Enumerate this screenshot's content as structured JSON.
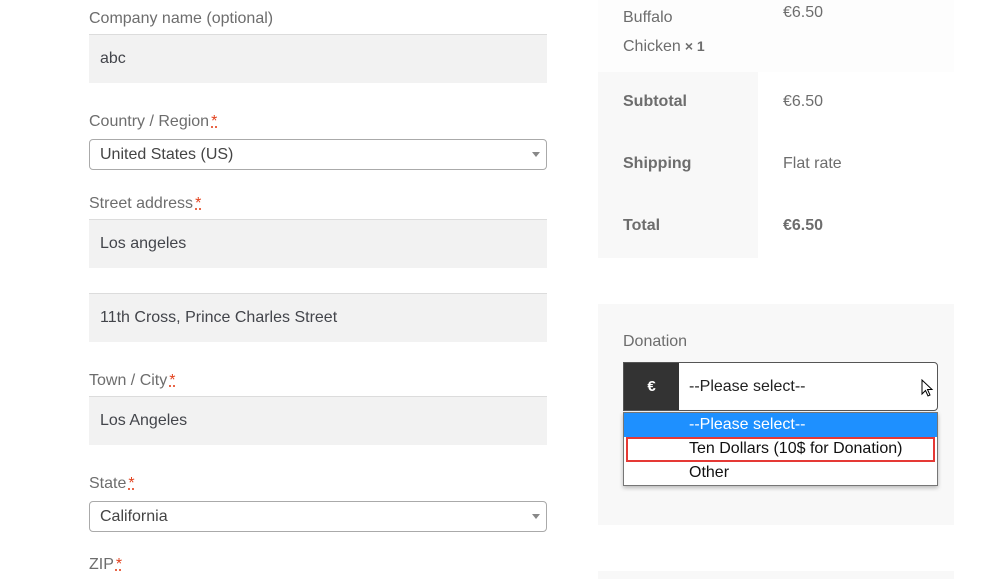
{
  "billing": {
    "company": {
      "label": "Company name (optional)",
      "value": "abc"
    },
    "country": {
      "label": "Country / Region",
      "required_mark": "*",
      "value": "United States (US)"
    },
    "street": {
      "label": "Street address",
      "required_mark": "*",
      "line1": "Los angeles",
      "line2": "11th Cross, Prince Charles Street"
    },
    "city": {
      "label": "Town / City",
      "required_mark": "*",
      "value": "Los Angeles"
    },
    "state": {
      "label": "State",
      "required_mark": "*",
      "value": "California"
    },
    "zip": {
      "label": "ZIP",
      "required_mark": "*"
    }
  },
  "order": {
    "item": {
      "name_line1": "Buffalo",
      "name_line2": "Chicken",
      "qty": "× 1",
      "price": "€6.50"
    },
    "totals": [
      {
        "label": "Subtotal",
        "value": "€6.50"
      },
      {
        "label": "Shipping",
        "value": "Flat rate"
      },
      {
        "label": "Total",
        "value": "€6.50"
      }
    ]
  },
  "donation": {
    "label": "Donation",
    "currency_symbol": "€",
    "selected": "--Please select--",
    "options": [
      "--Please select--",
      "Ten Dollars (10$ for Donation)",
      "Other"
    ],
    "highlighted_option_index": 1,
    "highlight_color": "#e53935",
    "selected_color": "#1e90ff"
  }
}
